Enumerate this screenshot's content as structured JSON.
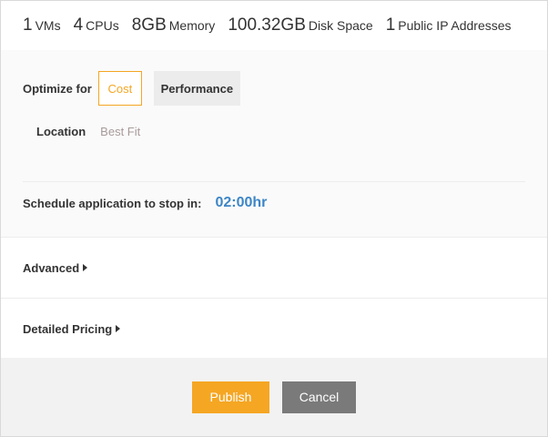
{
  "summary": {
    "items": [
      {
        "num": "1",
        "unit": "VMs"
      },
      {
        "num": "4",
        "unit": "CPUs"
      },
      {
        "num": "8GB",
        "unit": "Memory"
      },
      {
        "num": "100.32GB",
        "unit": "Disk Space"
      },
      {
        "num": "1",
        "unit": "Public IP Addresses"
      }
    ]
  },
  "config": {
    "optimize_label": "Optimize for",
    "options": [
      "Cost",
      "Performance"
    ],
    "selected_option": "Cost",
    "location_label": "Location",
    "location_value": "Best Fit",
    "schedule_label": "Schedule application to stop in:",
    "schedule_value": "02:00hr"
  },
  "sections": {
    "advanced_label": "Advanced",
    "pricing_label": "Detailed Pricing"
  },
  "actions": {
    "publish_label": "Publish",
    "cancel_label": "Cancel"
  },
  "colors": {
    "accent": "#f5a623",
    "link_blue": "#3d85c6",
    "cancel_gray": "#7a7a7a"
  }
}
